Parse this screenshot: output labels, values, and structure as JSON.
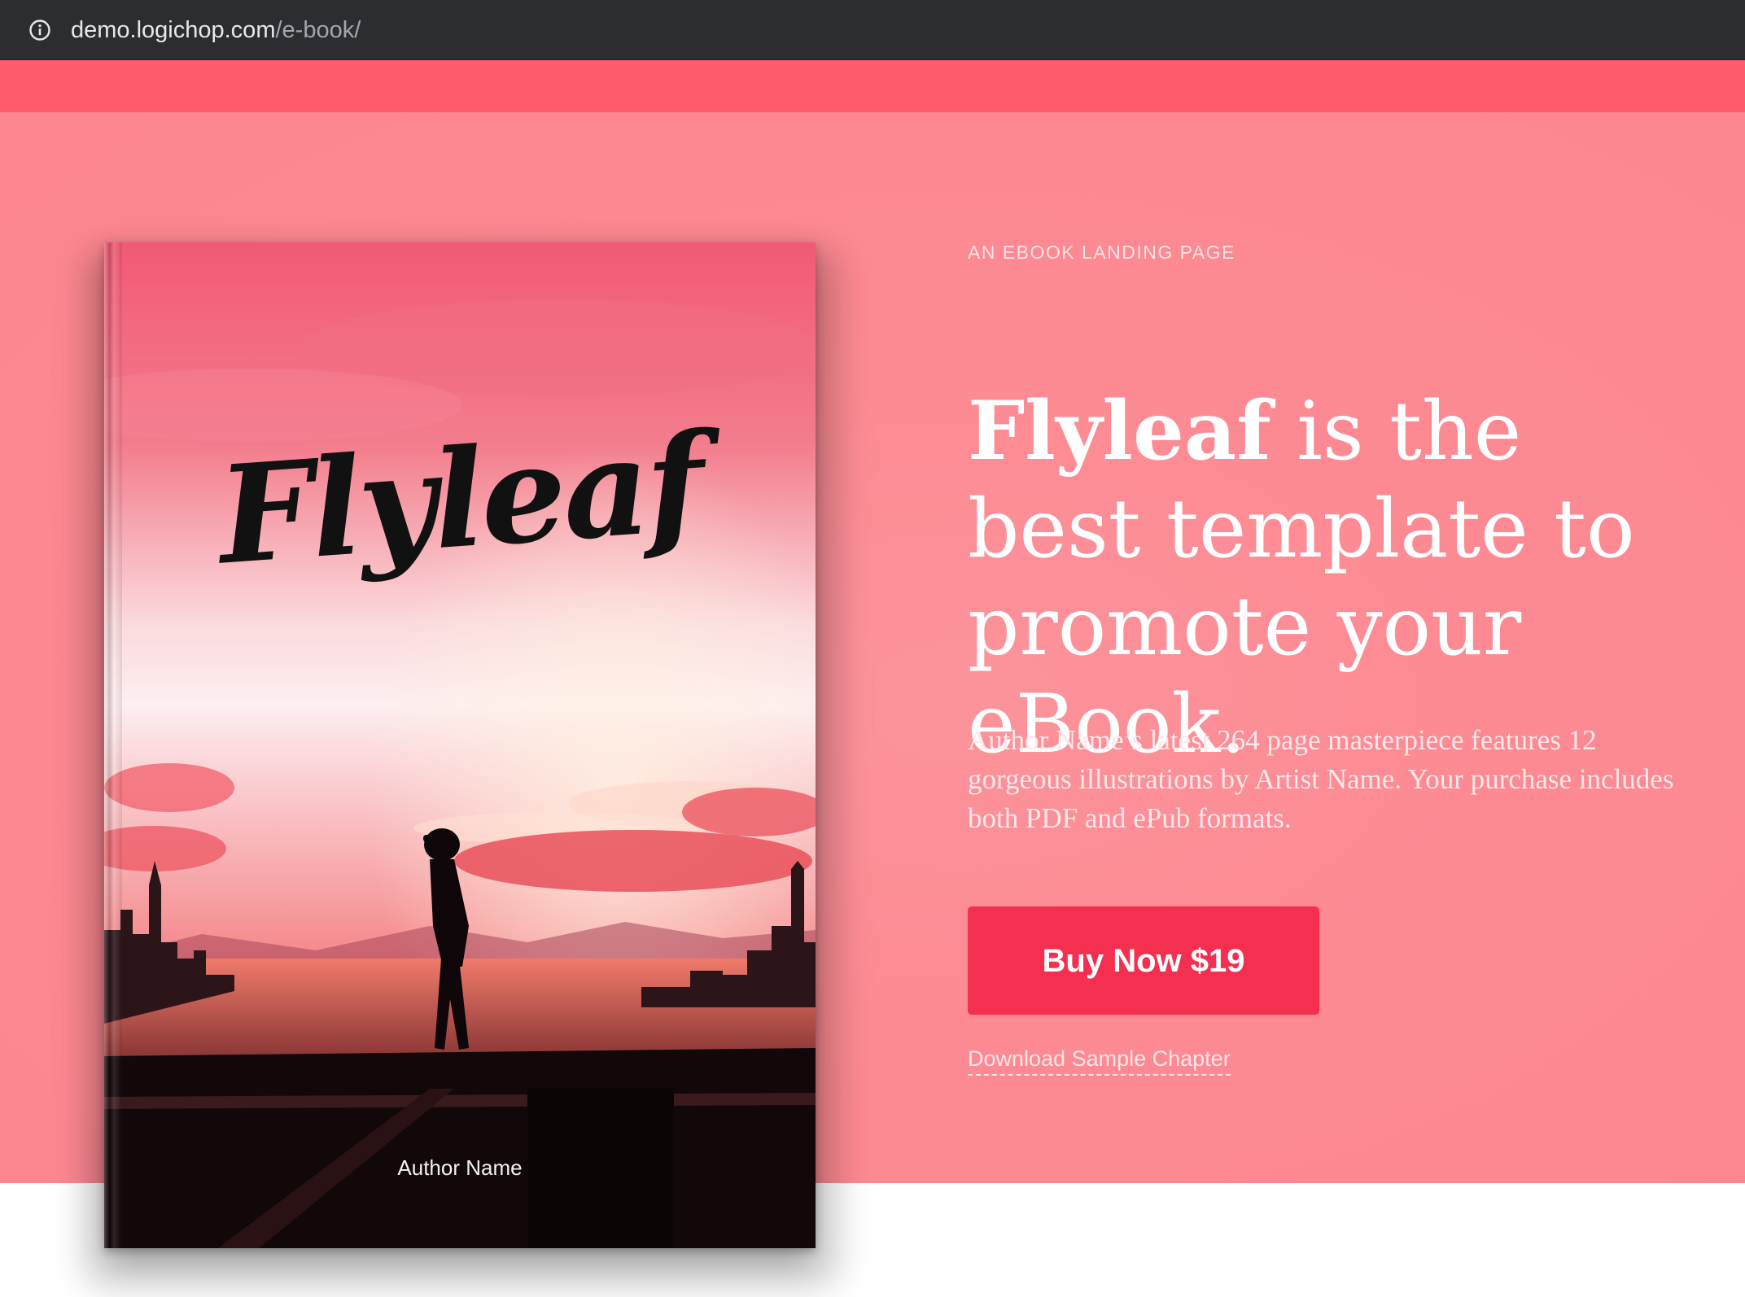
{
  "browser": {
    "url_host": "demo.logichop.com",
    "url_path": "/e-book/",
    "info_icon": "info-circle-icon"
  },
  "colors": {
    "top_accent": "#fe5c6d",
    "hero_background": "#fd8a93",
    "button": "#f42f50"
  },
  "book": {
    "title": "Flyleaf",
    "author": "Author Name"
  },
  "hero": {
    "eyebrow": "AN EBOOK LANDING PAGE",
    "headline_brand": "Flyleaf",
    "headline_rest": " is the best template to promote your eBook.",
    "description": "Author Name’s latest 264 page masterpiece features 12 gorgeous illustrations by Artist Name. Your purchase includes both PDF and ePub formats.",
    "buy_button_label": "Buy Now $19",
    "sample_link_label": "Download Sample Chapter"
  }
}
